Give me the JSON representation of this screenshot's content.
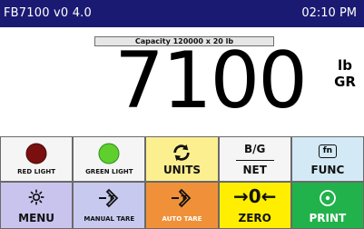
{
  "header": {
    "title": "FB7100 v0 4.0",
    "time": "02:10 PM"
  },
  "display": {
    "capacity": "Capacity 120000 x 20 lb",
    "weight": "7100",
    "unit": "lb",
    "mode": "GR"
  },
  "softkeys": {
    "red_light": "RED LIGHT",
    "green_light": "GREEN LIGHT",
    "units": "UNITS",
    "bg_top": "B/G",
    "bg_bottom": "NET",
    "func_icon": "fn",
    "func": "FUNC",
    "menu": "MENU",
    "manual_tare": "MANUAL TARE",
    "auto_tare": "AUTO TARE",
    "zero_symbol": "→0←",
    "zero": "ZERO",
    "print": "PRINT"
  },
  "colors": {
    "header_bg": "#1b1a73",
    "red_light": "#7a0f0f",
    "green_light": "#5fcf2e",
    "units_bg": "#fcef8f",
    "auto_tare_bg": "#f0913a",
    "zero_bg": "#ffee00",
    "print_bg": "#21b24b"
  },
  "icons": [
    "red-light-icon",
    "green-light-icon",
    "refresh-icon",
    "fn-icon",
    "gear-icon",
    "tare-arrow-icon",
    "zero-icon",
    "print-circle-icon"
  ]
}
